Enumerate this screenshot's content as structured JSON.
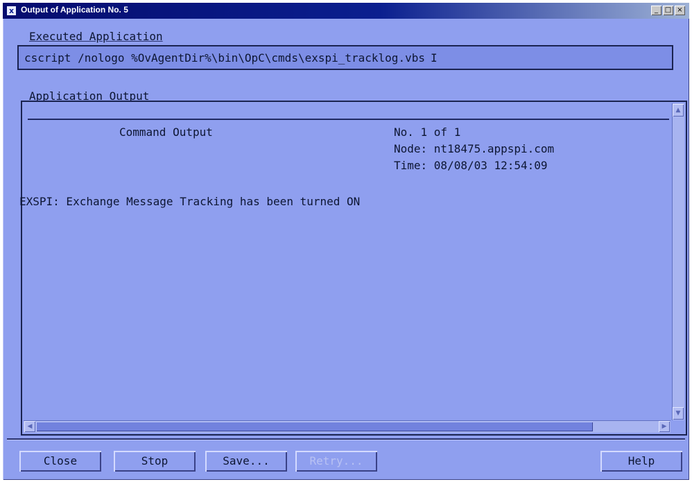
{
  "window": {
    "title": "Output of Application No. 5",
    "icon_glyph": "x",
    "controls": {
      "minimize": "_",
      "maximize": "□",
      "close": "×"
    }
  },
  "executed_application": {
    "label": "Executed Application",
    "command": "cscript /nologo %OvAgentDir%\\bin\\OpC\\cmds\\exspi_tracklog.vbs"
  },
  "application_output": {
    "label": "Application Output",
    "header_title": "Command Output",
    "count_text": "No. 1 of 1",
    "node_text": "Node: nt18475.appspi.com",
    "time_text": "Time: 08/08/03 12:54:09",
    "message": "EXSPI: Exchange Message Tracking has been turned ON"
  },
  "buttons": {
    "close": "Close",
    "stop": "Stop",
    "save": "Save...",
    "retry": "Retry...",
    "help": "Help"
  },
  "colors": {
    "background": "#8f9fef",
    "titlebar": "#0b1f8f",
    "text": "#0d1633"
  }
}
